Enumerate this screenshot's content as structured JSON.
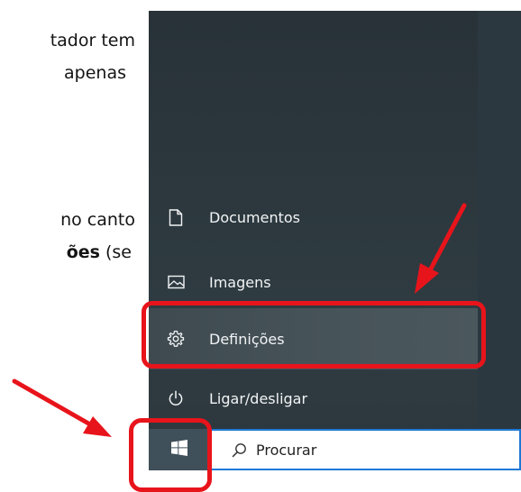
{
  "document_text": {
    "line1": "tador tem",
    "line2": "apenas",
    "line3": "no canto",
    "line4_bold": "ões",
    "line4_tail": " (se"
  },
  "start_menu": {
    "items": [
      {
        "label": "Documentos",
        "icon": "document-icon"
      },
      {
        "label": "Imagens",
        "icon": "pictures-icon"
      },
      {
        "label": "Definições",
        "icon": "gear-icon"
      },
      {
        "label": "Ligar/desligar",
        "icon": "power-icon"
      }
    ]
  },
  "taskbar": {
    "start_icon": "windows-logo-icon",
    "search_placeholder": "Procurar"
  },
  "colors": {
    "annotation_red": "#e8141b",
    "search_border_blue": "#1e78d6",
    "menu_background": "#2c383e",
    "selected_item": "#47545a"
  }
}
